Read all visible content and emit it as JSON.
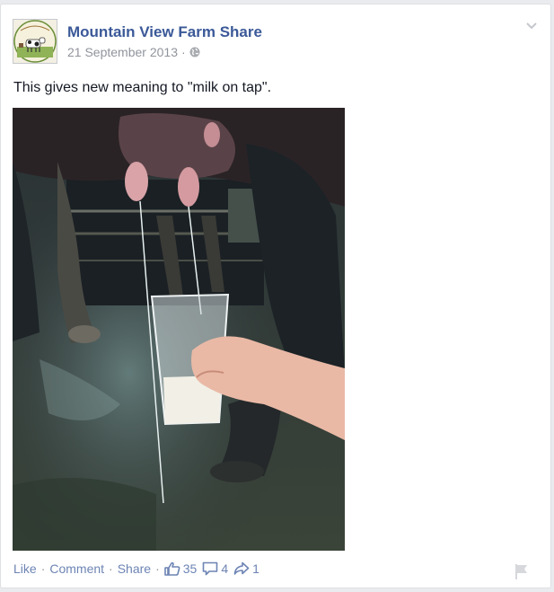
{
  "post": {
    "page_name": "Mountain View Farm Share",
    "date": "21 September 2013",
    "audience_icon": "globe-icon",
    "message": "This gives new meaning to \"milk on tap\".",
    "photo_description_icon": "photo-cow-milking-glass"
  },
  "actions": {
    "like_label": "Like",
    "comment_label": "Comment",
    "share_label": "Share",
    "separator": "·",
    "likes_count": "35",
    "comments_count": "4",
    "shares_count": "1"
  },
  "icons": {
    "options": "chevron-down-icon",
    "like": "thumbs-up-icon",
    "comment": "comment-icon",
    "share": "share-arrow-icon",
    "report": "flag-icon"
  },
  "colors": {
    "link": "#3b5998",
    "action_link": "#6d84b4",
    "meta": "#90949c"
  }
}
